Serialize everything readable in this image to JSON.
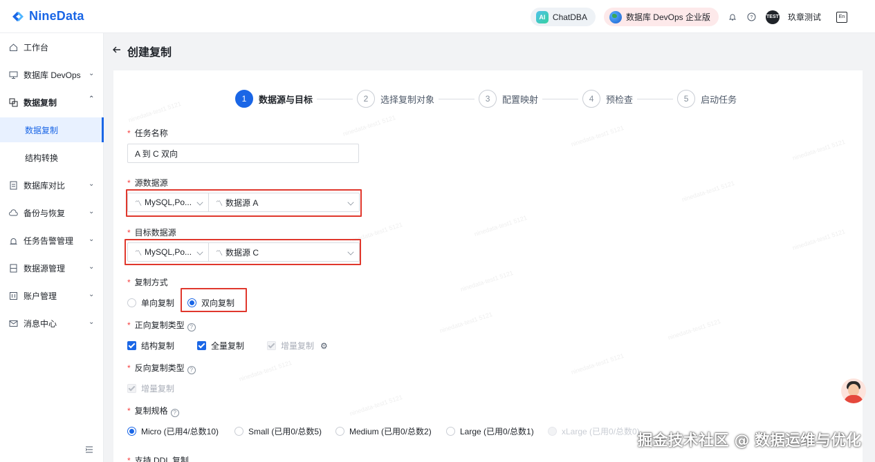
{
  "brand": {
    "name": "NineData"
  },
  "topbar": {
    "chatdba": "ChatDBA",
    "ai_badge": "AI",
    "edition": "数据库 DevOps 企业版",
    "avatar_text": "TEST",
    "user": "玖章测试",
    "lang_text": "En"
  },
  "sidebar": {
    "items": [
      {
        "label": "工作台",
        "icon": "home-icon"
      },
      {
        "label": "数据库 DevOps",
        "icon": "monitor-icon"
      },
      {
        "label": "数据复制",
        "icon": "copy-icon"
      },
      {
        "label": "数据库对比",
        "icon": "compare-icon"
      },
      {
        "label": "备份与恢复",
        "icon": "cloud-icon"
      },
      {
        "label": "任务告警管理",
        "icon": "alarm-icon"
      },
      {
        "label": "数据源管理",
        "icon": "datasource-icon"
      },
      {
        "label": "账户管理",
        "icon": "account-icon"
      },
      {
        "label": "消息中心",
        "icon": "mail-icon"
      }
    ],
    "sub_items": [
      "数据复制",
      "结构转换"
    ]
  },
  "page": {
    "title": "创建复制"
  },
  "steps": [
    {
      "num": "1",
      "label": "数据源与目标"
    },
    {
      "num": "2",
      "label": "选择复制对象"
    },
    {
      "num": "3",
      "label": "配置映射"
    },
    {
      "num": "4",
      "label": "预检查"
    },
    {
      "num": "5",
      "label": "启动任务"
    }
  ],
  "form": {
    "task_name_label": "任务名称",
    "task_name_value": "A 到 C 双向",
    "source_label": "源数据源",
    "source_type": "MySQL,Po...",
    "source_name": "数据源 A",
    "target_label": "目标数据源",
    "target_type": "MySQL,Po...",
    "target_name": "数据源 C",
    "mode_label": "复制方式",
    "mode_one_way": "单向复制",
    "mode_two_way": "双向复制",
    "forward_label": "正向复制类型",
    "forward_structure": "结构复制",
    "forward_full": "全量复制",
    "forward_incremental": "增量复制",
    "reverse_label": "反向复制类型",
    "reverse_incremental": "增量复制",
    "spec_label": "复制规格",
    "spec_options": [
      "Micro (已用4/总数10)",
      "Small (已用0/总数5)",
      "Medium (已用0/总数2)",
      "Large (已用0/总数1)",
      "xLarge (已用0/总数0)"
    ],
    "ddl_label": "支持 DDL 复制"
  },
  "watermark": "ninedata-test1 5121",
  "overlay_caption": "掘金技术社区 @ 数据运维与优化",
  "colors": {
    "primary": "#1a66e6",
    "highlight_box": "#e0372c",
    "required": "#f53f3f"
  }
}
